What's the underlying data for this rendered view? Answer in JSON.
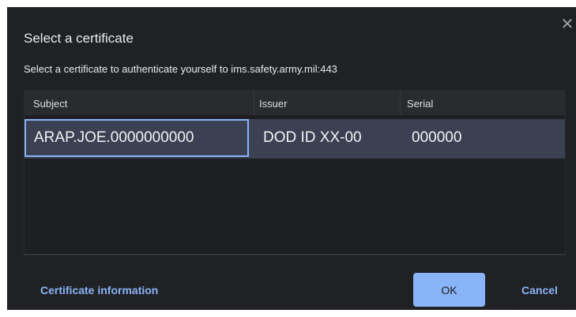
{
  "dialog": {
    "title": "Select a certificate",
    "subtitle": "Select a certificate to authenticate yourself to ims.safety.army.mil:443",
    "close_icon": "close-icon"
  },
  "table": {
    "columns": [
      "Subject",
      "Issuer",
      "Serial"
    ],
    "rows": [
      {
        "subject": "ARAP.JOE.0000000000",
        "issuer": "DOD ID XX-00",
        "serial": "000000"
      }
    ]
  },
  "footer": {
    "info_link": "Certificate information",
    "ok_label": "OK",
    "cancel_label": "Cancel"
  },
  "colors": {
    "dialog_bg": "#202124",
    "accent": "#8ab4f8",
    "selected_row": "#3b4153"
  }
}
